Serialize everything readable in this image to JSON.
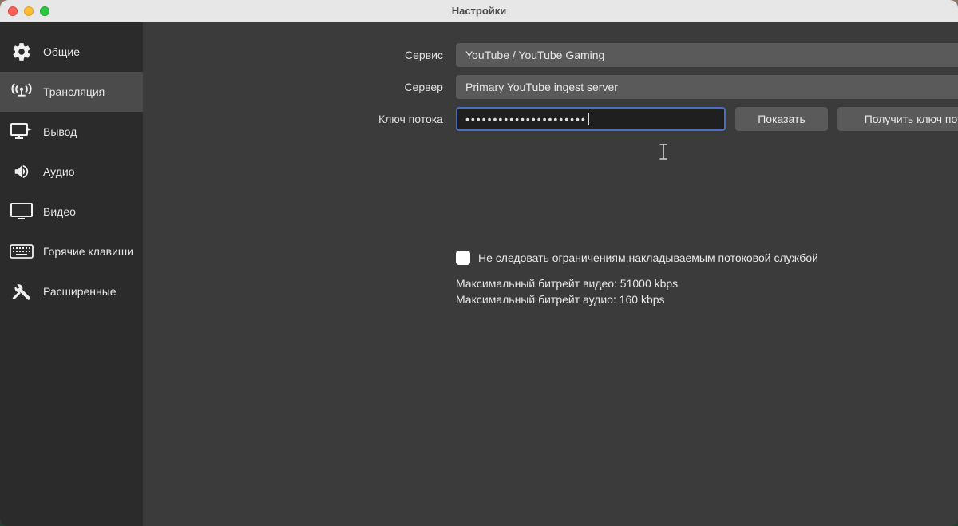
{
  "window": {
    "title": "Настройки"
  },
  "sidebar": {
    "items": [
      {
        "label": "Общие"
      },
      {
        "label": "Трансляция"
      },
      {
        "label": "Вывод"
      },
      {
        "label": "Аудио"
      },
      {
        "label": "Видео"
      },
      {
        "label": "Горячие клавиши"
      },
      {
        "label": "Расширенные"
      }
    ]
  },
  "form": {
    "service_label": "Сервис",
    "service_value": "YouTube / YouTube Gaming",
    "server_label": "Сервер",
    "server_value": "Primary YouTube ingest server",
    "key_label": "Ключ потока",
    "key_value": "••••••••••••••••••••••",
    "show_btn": "Показать",
    "get_key_btn": "Получить ключ потока"
  },
  "info": {
    "checkbox_label": "Не следовать ограничениям,накладываемым потоковой службой",
    "max_video": "Максимальный битрейт видео: 51000 kbps",
    "max_audio": "Максимальный битрейт аудио: 160 kbps"
  }
}
